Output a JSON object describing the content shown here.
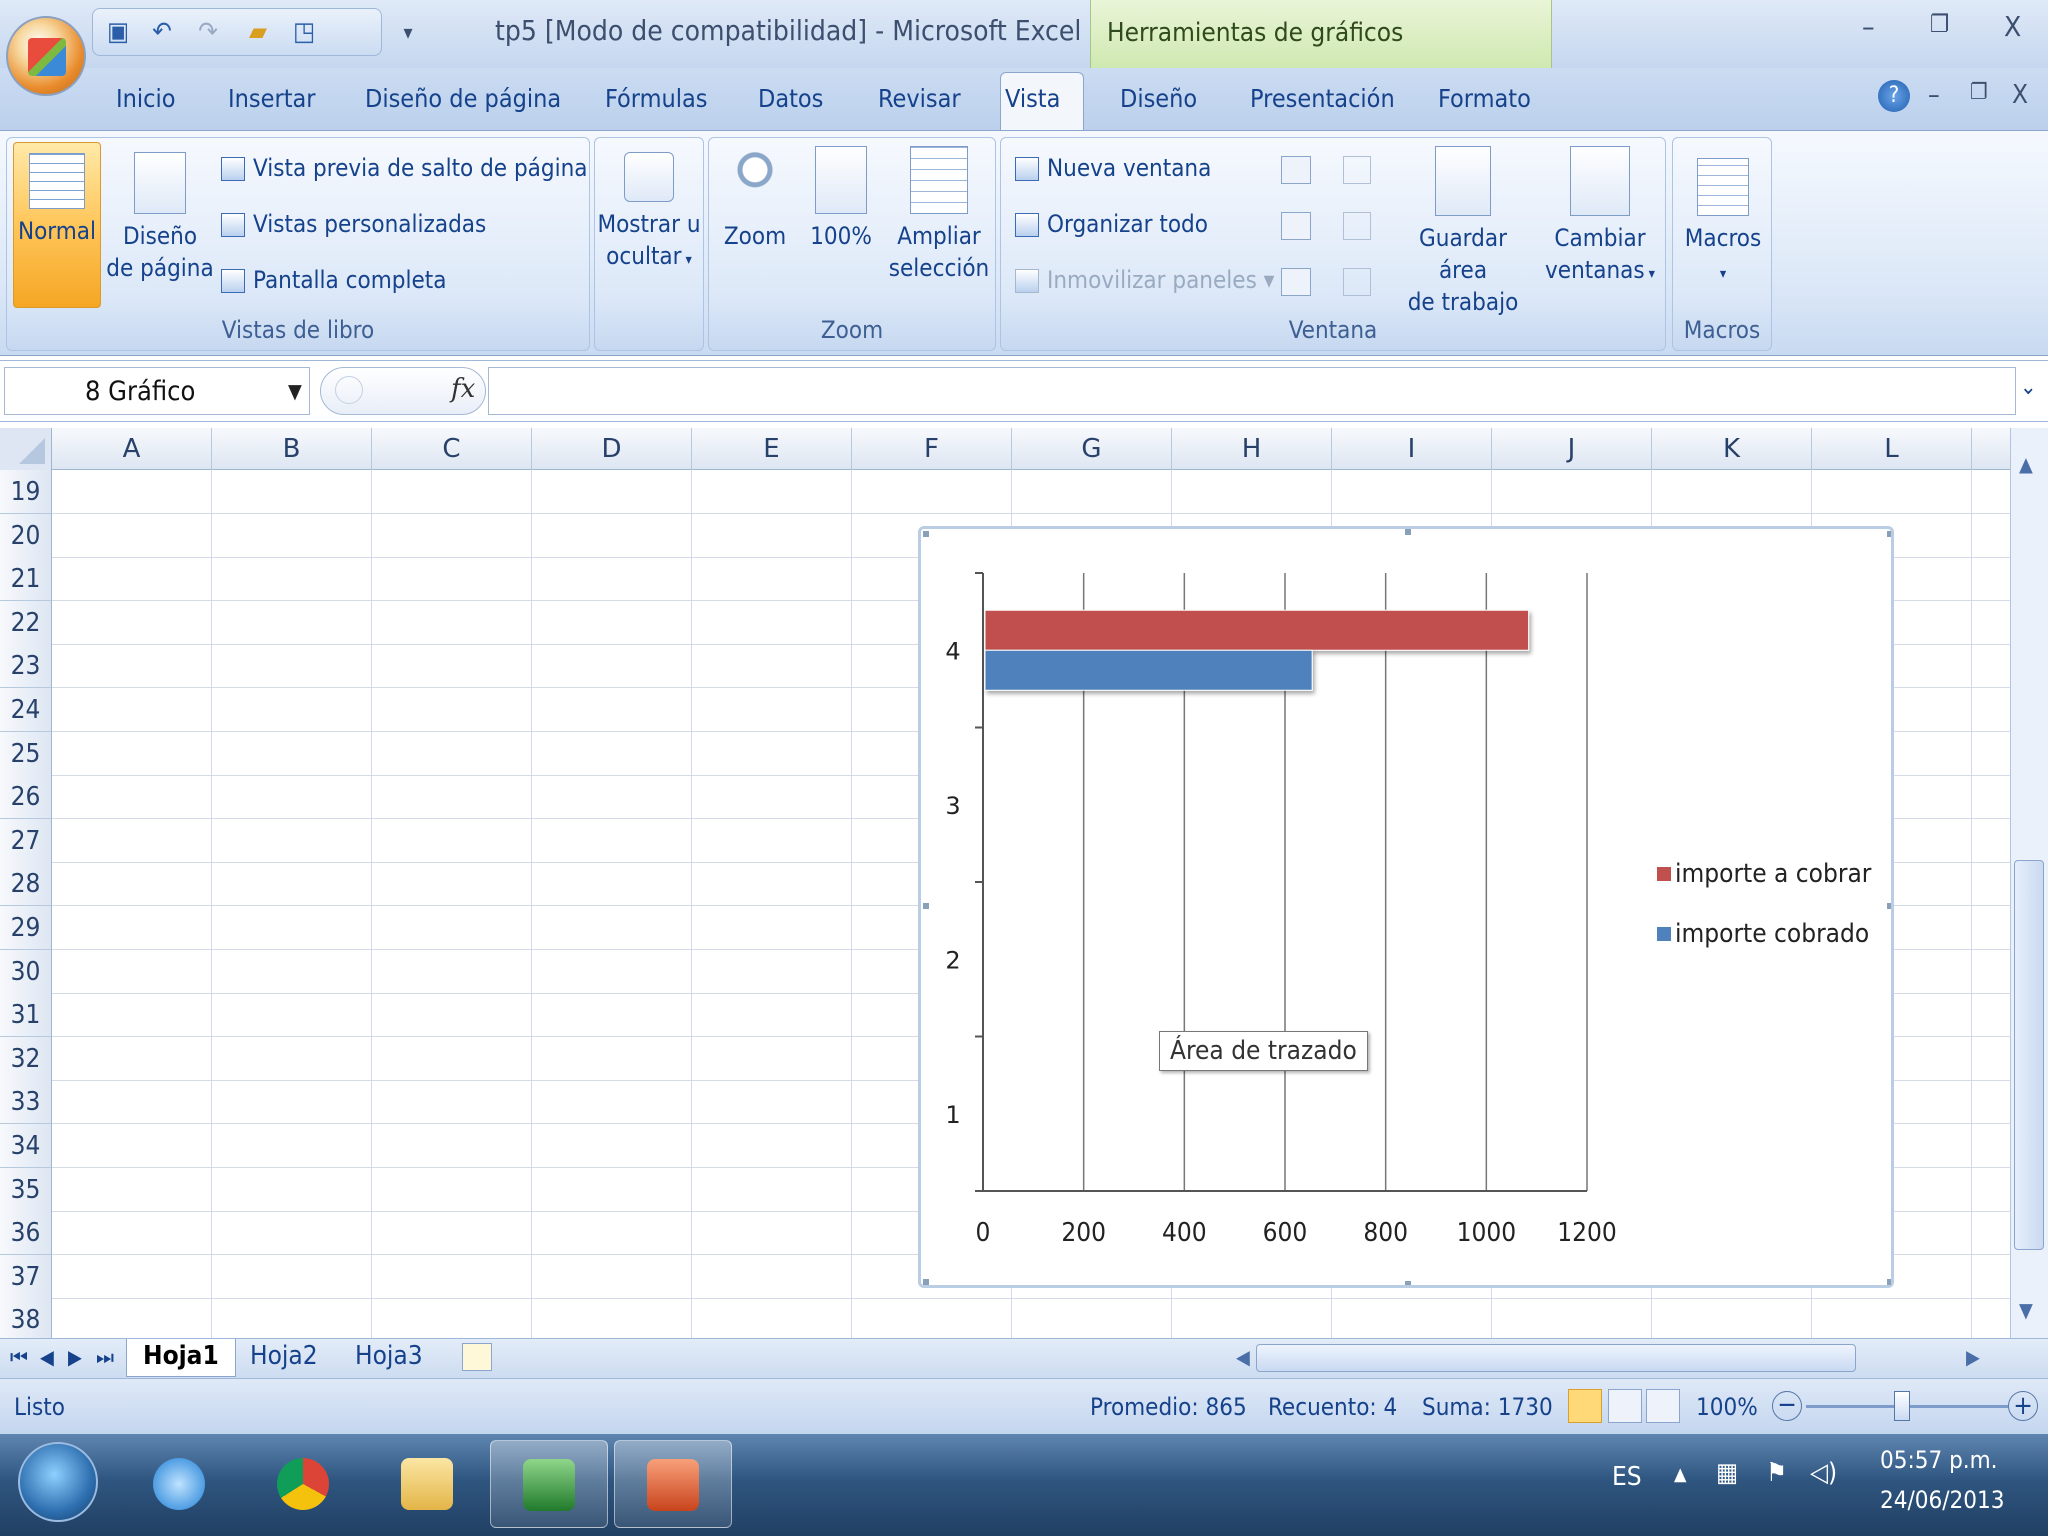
{
  "window": {
    "title": "tp5  [Modo de compatibilidad] - Microsoft Excel",
    "tools_tab": "Herramientas de gráficos",
    "min": "–",
    "restore": "❐",
    "close": "X"
  },
  "tabs": [
    "Inicio",
    "Insertar",
    "Diseño de página",
    "Fórmulas",
    "Datos",
    "Revisar",
    "Vista",
    "Diseño",
    "Presentación",
    "Formato"
  ],
  "ribbon": {
    "vistas": {
      "label": "Vistas de libro",
      "normal": "Normal",
      "diseno1": "Diseño",
      "diseno2": "de página",
      "salto": "Vista previa de salto de página",
      "personalizadas": "Vistas personalizadas",
      "completa": "Pantalla completa"
    },
    "mostrar": {
      "l1": "Mostrar u",
      "l2": "ocultar"
    },
    "zoom": {
      "label": "Zoom",
      "zoom": "Zoom",
      "cien": "100%",
      "ampliar1": "Ampliar",
      "ampliar2": "selección"
    },
    "ventana": {
      "label": "Ventana",
      "nueva": "Nueva ventana",
      "organizar": "Organizar todo",
      "inmovilizar": "Inmovilizar paneles",
      "guardar1": "Guardar área",
      "guardar2": "de trabajo",
      "cambiar1": "Cambiar",
      "cambiar2": "ventanas"
    },
    "macros": {
      "label": "Macros",
      "btn": "Macros"
    }
  },
  "formula": {
    "name_box": "8 Gráfico",
    "fx": "fx"
  },
  "grid": {
    "columns": [
      "A",
      "B",
      "C",
      "D",
      "E",
      "F",
      "G",
      "H",
      "I",
      "J",
      "K",
      "L"
    ],
    "rows": [
      "19",
      "20",
      "21",
      "22",
      "23",
      "24",
      "25",
      "26",
      "27",
      "28",
      "29",
      "30",
      "31",
      "32",
      "33",
      "34",
      "35",
      "36",
      "37",
      "38"
    ]
  },
  "chart_data": {
    "type": "bar",
    "orientation": "horizontal",
    "categories": [
      "1",
      "2",
      "3",
      "4"
    ],
    "series": [
      {
        "name": "importe a cobrar",
        "color": "#c0504d",
        "values": [
          null,
          null,
          null,
          1080
        ]
      },
      {
        "name": "importe cobrado",
        "color": "#4f81bd",
        "values": [
          null,
          null,
          null,
          650
        ]
      }
    ],
    "xticks": [
      "0",
      "200",
      "400",
      "600",
      "800",
      "1000",
      "1200"
    ],
    "xlim": [
      0,
      1200
    ],
    "grid": "vertical",
    "legend": "right",
    "tooltip": "Área de trazado"
  },
  "sheets": [
    "Hoja1",
    "Hoja2",
    "Hoja3"
  ],
  "status": {
    "ready": "Listo",
    "promedio": "Promedio: 865",
    "recuento": "Recuento: 4",
    "suma": "Suma: 1730",
    "zoom": "100%"
  },
  "tray": {
    "lang": "ES",
    "time": "05:57 p.m.",
    "date": "24/06/2013"
  }
}
